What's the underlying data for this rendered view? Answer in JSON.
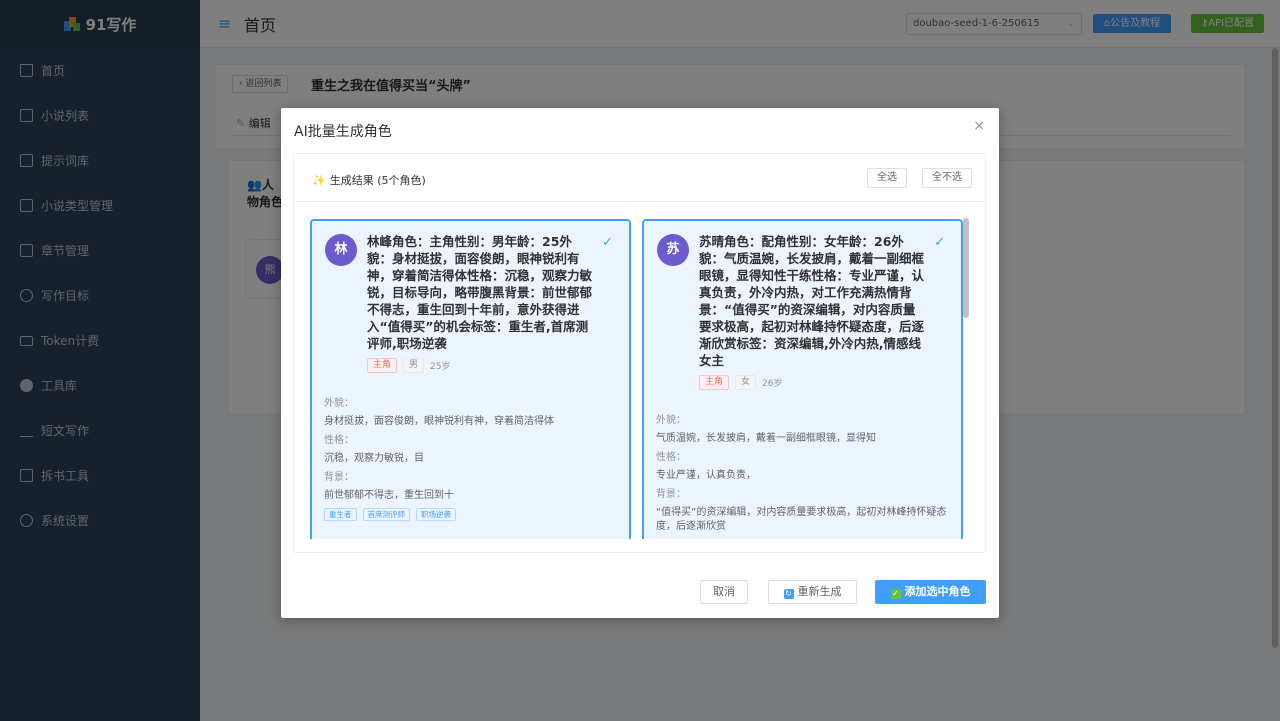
{
  "app": {
    "name": "91写作",
    "colors": {
      "sidebar": "#304156",
      "accent": "#409eff",
      "success": "#67c23a",
      "danger": "#f56c6c"
    }
  },
  "sidebar": {
    "items": [
      {
        "label": "首页",
        "icon": "home-icon"
      },
      {
        "label": "小说列表",
        "icon": "document-icon"
      },
      {
        "label": "提示词库",
        "icon": "message-icon"
      },
      {
        "label": "小说类型管理",
        "icon": "save-icon"
      },
      {
        "label": "章节管理",
        "icon": "book-icon"
      },
      {
        "label": "写作目标",
        "icon": "target-icon"
      },
      {
        "label": "Token计费",
        "icon": "card-icon"
      },
      {
        "label": "工具库",
        "icon": "gear-icon"
      },
      {
        "label": "短文写作",
        "icon": "pen-icon"
      },
      {
        "label": "拆书工具",
        "icon": "cart-icon"
      },
      {
        "label": "系统设置",
        "icon": "settings-icon"
      }
    ]
  },
  "header": {
    "title": "首页",
    "model": "doubao-seed-1-6-250615",
    "notice_label": "公告及教程",
    "api_label": "API已配置"
  },
  "page": {
    "back_label": "返回列表",
    "novel_title": "重生之我在值得买当“头牌”",
    "tab_edit": "编辑",
    "section_title_1": "人",
    "section_title_2": "物角色",
    "bg_avatar": "熊"
  },
  "dialog": {
    "title": "AI批量生成角色",
    "result_title": "生成结果 (5个角色)",
    "select_all": "全选",
    "select_none": "全不选",
    "cancel": "取消",
    "regenerate": "重新生成",
    "add_selected": "添加选中角色"
  },
  "characters": [
    {
      "avatar": "林",
      "headline": "林峰角色：主角性别：男年龄：25外貌：身材挺拔，面容俊朗，眼神锐利有神，穿着简洁得体性格：沉稳，观察力敏锐，目标导向，略带腹黑背景：前世郁郁不得志，重生回到十年前，意外获得进入“值得买”的机会标签：重生者,首席测评师,职场逆袭",
      "role": "主角",
      "gender": "男",
      "age": "25岁",
      "appearance_label": "外貌：",
      "appearance": "身材挺拔，面容俊朗，眼神锐利有神，穿着简洁得体",
      "personality_label": "性格：",
      "personality": "沉稳，观察力敏锐，目",
      "background_label": "背景：",
      "background": "前世郁郁不得志，重生回到十",
      "tags": [
        "重生者",
        "首席测评师",
        "职场逆袭"
      ]
    },
    {
      "avatar": "苏",
      "headline": "苏晴角色：配角性别：女年龄：26外貌：气质温婉，长发披肩，戴着一副细框眼镜，显得知性干练性格：专业严谨，认真负责，外冷内热，对工作充满热情背景：“值得买”的资深编辑，对内容质量要求极高，起初对林峰持怀疑态度，后逐渐欣赏标签：资深编辑,外冷内热,情感线女主",
      "role": "主角",
      "gender": "女",
      "age": "26岁",
      "appearance_label": "外貌：",
      "appearance": "气质温婉，长发披肩，戴着一副细框眼镜，显得知",
      "personality_label": "性格：",
      "personality": "专业严谨，认真负责，",
      "background_label": "背景：",
      "background": "“值得买”的资深编辑，对内容质量要求极高，起初对林峰持怀疑态度，后逐渐欣赏"
    }
  ]
}
